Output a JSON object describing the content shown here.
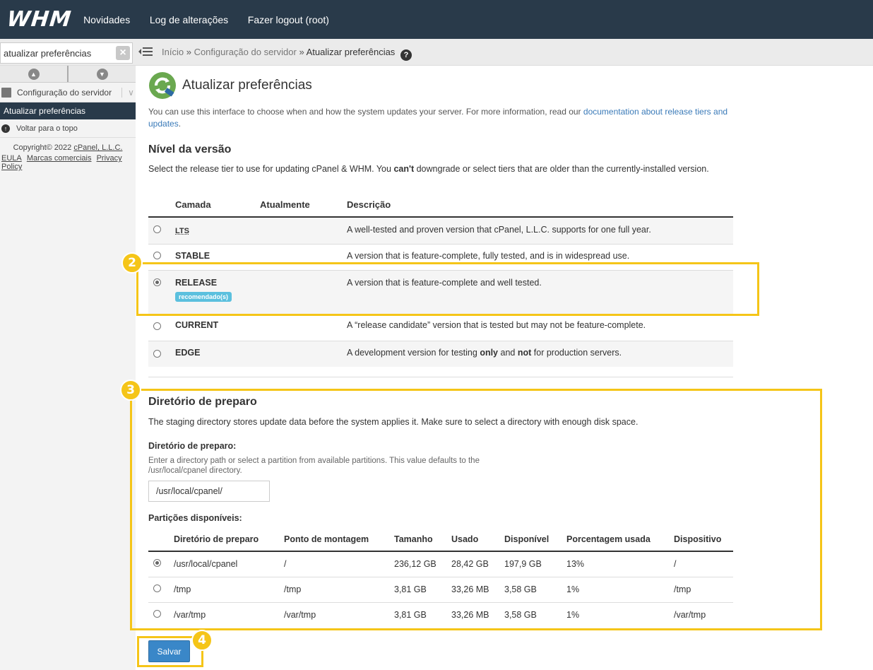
{
  "header": {
    "logo": "WHM",
    "nav": [
      "Novidades",
      "Log de alterações",
      "Fazer logout (root)"
    ]
  },
  "search": {
    "value": "atualizar preferências"
  },
  "breadcrumb": {
    "home": "Início",
    "section": "Configuração do servidor",
    "current": "Atualizar preferências",
    "sep": "»"
  },
  "sidebar": {
    "category": "Configuração do servidor",
    "active_item": "Atualizar preferências",
    "back_to_top": "Voltar para o topo",
    "copyright_prefix": "Copyright© 2022",
    "copyright_company": "cPanel, L.L.C.",
    "links": [
      "EULA",
      "Marcas comerciais",
      "Privacy Policy"
    ]
  },
  "page": {
    "title": "Atualizar preferências",
    "intro_text": "You can use this interface to choose when and how the system updates your server. For more information, read our",
    "intro_link": "documentation about release tiers and updates",
    "intro_end": "."
  },
  "release_tier": {
    "heading": "Nível da versão",
    "desc_part1": "Select the release tier to use for updating cPanel & WHM. You",
    "desc_bold": "can't",
    "desc_part2": "downgrade or select tiers that are older than the currently-installed version.",
    "columns": [
      "Camada",
      "Atualmente",
      "Descrição"
    ],
    "tiers": [
      {
        "name": "LTS",
        "current": "",
        "description": "A well-tested and proven version that cPanel, L.L.C. supports for one full year.",
        "selected": false
      },
      {
        "name": "STABLE",
        "current": "",
        "description": "A version that is feature-complete, fully tested, and is in widespread use.",
        "selected": false
      },
      {
        "name": "RELEASE",
        "current": "",
        "description": "A version that is feature-complete and well tested.",
        "selected": true,
        "badge": "recomendado(s)"
      },
      {
        "name": "CURRENT",
        "current": "",
        "description": "A “release candidate” version that is tested but may not be feature-complete.",
        "selected": false
      },
      {
        "name": "EDGE",
        "current": "",
        "description_pre": "A development version for testing",
        "description_b1": "only",
        "description_mid": "and",
        "description_b2": "not",
        "description_post": "for production servers.",
        "selected": false
      }
    ]
  },
  "staging": {
    "heading": "Diretório de preparo",
    "description": "The staging directory stores update data before the system applies it. Make sure to select a directory with enough disk space.",
    "field_label": "Diretório de preparo:",
    "field_help": "Enter a directory path or select a partition from available partitions. This value defaults to the /usr/local/cpanel directory.",
    "field_value": "/usr/local/cpanel/",
    "partitions_label": "Partições disponíveis:",
    "columns": [
      "Diretório de preparo",
      "Ponto de montagem",
      "Tamanho",
      "Usado",
      "Disponível",
      "Porcentagem usada",
      "Dispositivo"
    ],
    "rows": [
      {
        "dir": "/usr/local/cpanel",
        "mount": "/",
        "size": "236,12 GB",
        "used": "28,42 GB",
        "avail": "197,9 GB",
        "pct": "13%",
        "device": "/",
        "selected": true
      },
      {
        "dir": "/tmp",
        "mount": "/tmp",
        "size": "3,81 GB",
        "used": "33,26 MB",
        "avail": "3,58 GB",
        "pct": "1%",
        "device": "/tmp",
        "selected": false
      },
      {
        "dir": "/var/tmp",
        "mount": "/var/tmp",
        "size": "3,81 GB",
        "used": "33,26 MB",
        "avail": "3,58 GB",
        "pct": "1%",
        "device": "/var/tmp",
        "selected": false
      }
    ]
  },
  "save_button": "Salvar",
  "callouts": [
    "2",
    "3",
    "4"
  ],
  "colors": {
    "topbar": "#293a4a",
    "accent": "#3a87c8",
    "callout": "#f5c518",
    "badge": "#5bc0de"
  }
}
